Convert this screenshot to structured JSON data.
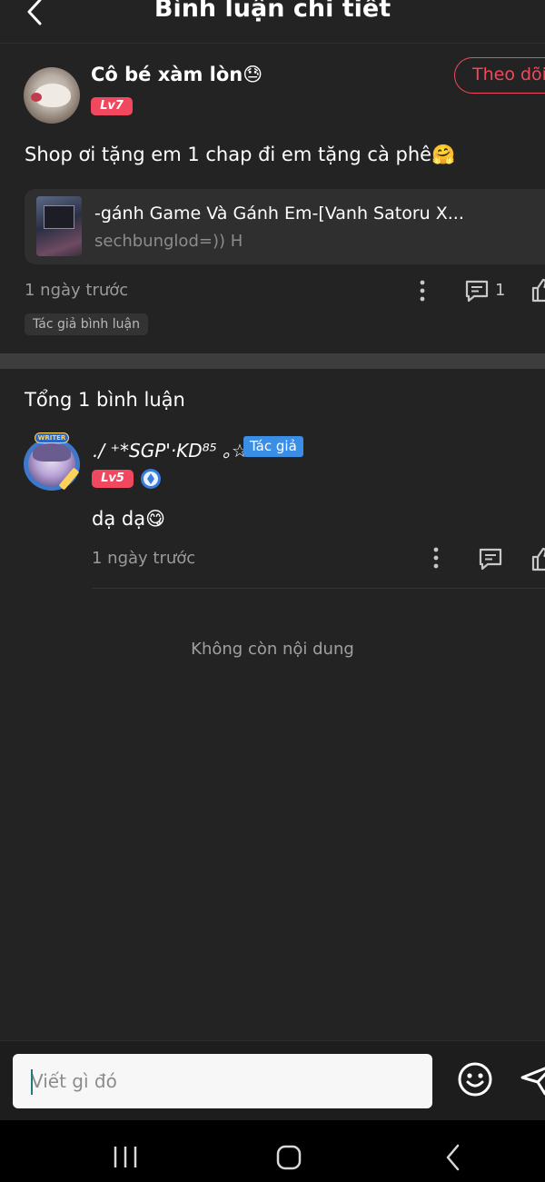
{
  "header": {
    "title": "Bình luận chi tiết"
  },
  "post": {
    "author": "Cô bé xàm lòn😓",
    "level": "Lv7",
    "follow_label": "Theo dõi",
    "text": "Shop ơi tặng em 1 chap đi em tặng cà phê🤗",
    "story": {
      "title": "-gánh Game Và Gánh Em-[Vanh Satoru X...",
      "subtitle": "sechbunglod=)) H"
    },
    "time": "1 ngày trước",
    "reply_count": "1",
    "tag": "Tác giả bình luận"
  },
  "replies": {
    "title": "Tổng 1 bình luận",
    "items": [
      {
        "author": "./ ⁺*SGP'·KD⁸⁵ ｡☆",
        "author_badge": "Tác giả",
        "avatar_tag": "WRITER",
        "level": "Lv5",
        "text": "dạ dạ😋",
        "time": "1 ngày trước"
      }
    ]
  },
  "end_text": "Không còn nội dung",
  "composer": {
    "placeholder": "Viết gì đó"
  },
  "colors": {
    "background": "#232323",
    "accent": "#f2485f",
    "author_badge": "#3a8ee6",
    "composer_bg": "#1d1d1d",
    "nav_bar": "#000000"
  },
  "icons": {
    "back": "chevron-left-icon",
    "more": "more-vertical-icon",
    "reply": "comment-icon",
    "like": "thumbs-up-icon",
    "tier": "diamond-badge-icon",
    "emoji": "smiley-icon",
    "send": "send-icon"
  }
}
